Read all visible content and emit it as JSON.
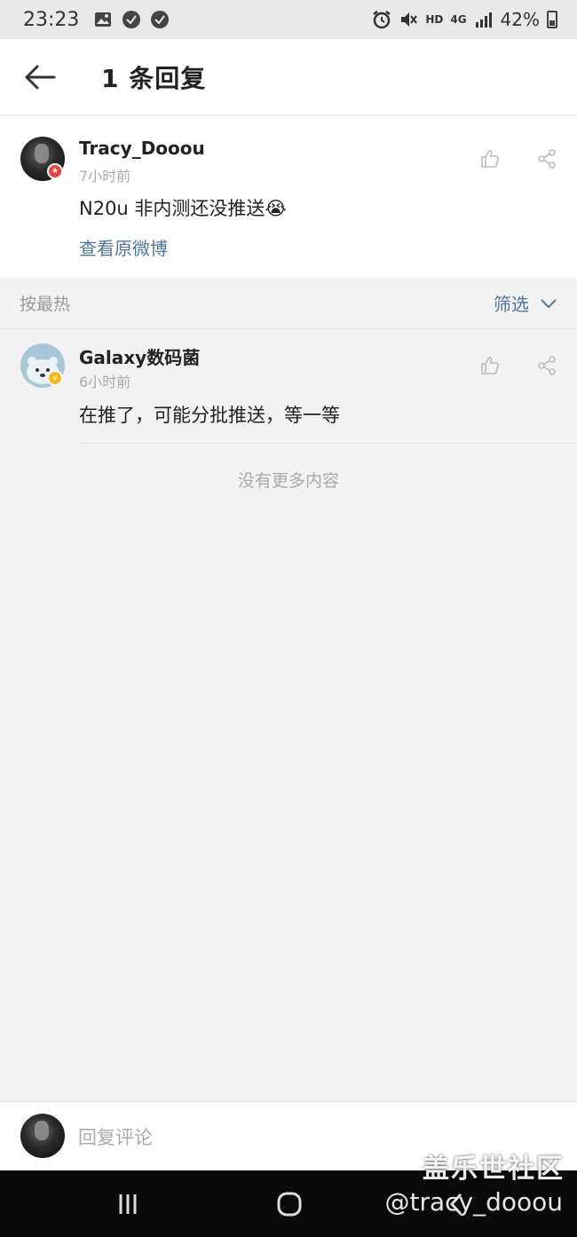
{
  "status_bar": {
    "time": "23:23",
    "network": "HD",
    "signal": "4G",
    "battery": "42%"
  },
  "header": {
    "title": "1 条回复"
  },
  "post": {
    "username": "Tracy_Dooou",
    "time": "7小时前",
    "text": "N20u 非内测还没推送",
    "emoji": "😭",
    "link": "查看原微博"
  },
  "sort_bar": {
    "sort_label": "按最热",
    "filter_label": "筛选"
  },
  "replies": [
    {
      "username": "Galaxy数码菌",
      "time": "6小时前",
      "text": "在推了，可能分批推送，等一等"
    }
  ],
  "no_more": "没有更多内容",
  "comment_bar": {
    "placeholder": "回复评论"
  },
  "watermark": {
    "title": "盖乐世社区",
    "handle": "@tracy_dooou"
  },
  "colors": {
    "link": "#52759c",
    "background": "#f2f2f2",
    "badge_red": "#e9413f",
    "badge_yellow": "#f6b81b"
  }
}
